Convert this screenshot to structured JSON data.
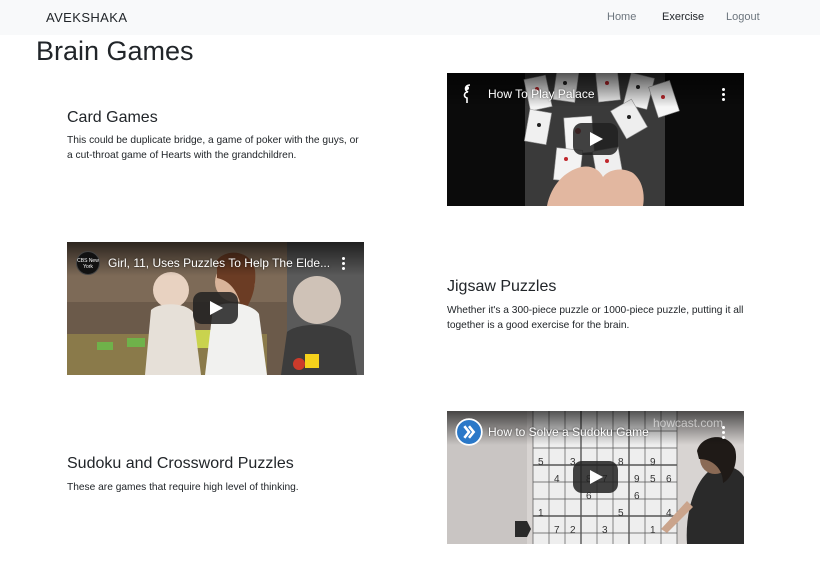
{
  "nav": {
    "brand": "AVEKSHAKA",
    "links": [
      {
        "label": "Home",
        "active": false
      },
      {
        "label": "Exercise",
        "active": true
      },
      {
        "label": "Logout",
        "active": false
      }
    ]
  },
  "page": {
    "title": "Brain Games"
  },
  "games": [
    {
      "title": "Card Games",
      "description": "This could be duplicate bridge, a game of poker with the guys, or a cut-throat game of Hearts with the grandchildren.",
      "video_title": "How To Play Palace",
      "channel_icon": "music-note-icon"
    },
    {
      "title": "Jigsaw Puzzles",
      "description": "Whether it's a 300-piece puzzle or 1000-piece puzzle, putting it all together is a good exercise for the brain.",
      "video_title": "Girl, 11, Uses Puzzles To Help The Elde...",
      "channel_icon": "cbs-new-york-icon",
      "channel_text": "CBS New York"
    },
    {
      "title": "Sudoku and Crossword Puzzles",
      "description": "These are games that require high level of thinking.",
      "video_title": "How to Solve a Sudoku Game",
      "channel_icon": "howcast-icon",
      "watermark": "howcast.com",
      "overlay_digits": [
        "5",
        "3",
        "8",
        "9",
        "4",
        "7",
        "6",
        "1",
        "2",
        "4",
        "6",
        "5",
        "7",
        "5",
        "6",
        "8",
        "9",
        "3",
        "1"
      ]
    }
  ],
  "colors": {
    "navbar_bg": "#f8f9fa",
    "nav_active": "#212529",
    "nav_muted": "#6c757d",
    "play_button": "#212121"
  }
}
